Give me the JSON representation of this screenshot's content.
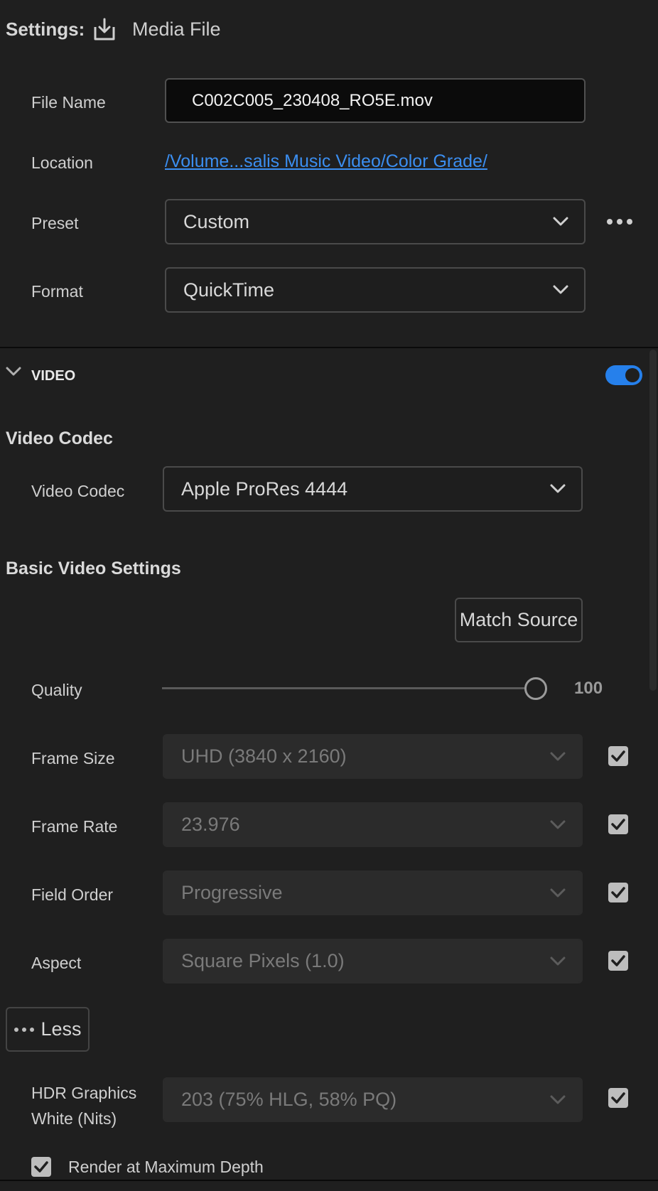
{
  "header": {
    "settings_label": "Settings:",
    "destination_label": "Media File"
  },
  "file_name": {
    "label": "File Name",
    "value": "C002C005_230408_RO5E.mov"
  },
  "location": {
    "label": "Location",
    "value": "/Volume...salis Music Video/Color Grade/"
  },
  "preset": {
    "label": "Preset",
    "value": "Custom"
  },
  "format": {
    "label": "Format",
    "value": "QuickTime"
  },
  "video_section": {
    "title": "VIDEO",
    "enabled": true
  },
  "video_codec": {
    "heading": "Video Codec",
    "label": "Video Codec",
    "value": "Apple ProRes 4444"
  },
  "basic_video": {
    "heading": "Basic Video Settings",
    "match_source_label": "Match Source",
    "quality": {
      "label": "Quality",
      "value": "100"
    },
    "frame_size": {
      "label": "Frame Size",
      "value": "UHD (3840 x 2160)",
      "checked": true
    },
    "frame_rate": {
      "label": "Frame Rate",
      "value": "23.976",
      "checked": true
    },
    "field_order": {
      "label": "Field Order",
      "value": "Progressive",
      "checked": true
    },
    "aspect": {
      "label": "Aspect",
      "value": "Square Pixels (1.0)",
      "checked": true
    },
    "less_label": "Less",
    "hdr_white": {
      "label_line1": "HDR Graphics",
      "label_line2": "White (Nits)",
      "value": "203 (75% HLG, 58% PQ)",
      "checked": true
    },
    "render_max_depth": {
      "label": "Render at Maximum Depth",
      "checked": true
    }
  },
  "colors": {
    "accent": "#2680eb",
    "link": "#3b8ef0",
    "background": "#1f1f1f"
  }
}
